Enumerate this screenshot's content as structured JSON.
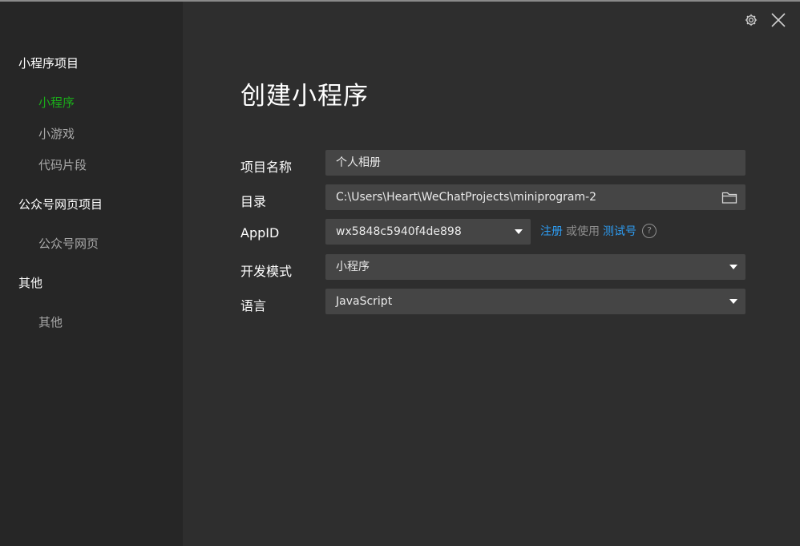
{
  "sidebar": {
    "groups": [
      {
        "title": "小程序项目",
        "items": [
          "小程序",
          "小游戏",
          "代码片段"
        ]
      },
      {
        "title": "公众号网页项目",
        "items": [
          "公众号网页"
        ]
      },
      {
        "title": "其他",
        "items": [
          "其他"
        ]
      }
    ],
    "active_item": "小程序"
  },
  "header": {
    "settings_icon": "gear-icon",
    "close_icon": "close-icon"
  },
  "main": {
    "title": "创建小程序",
    "form": {
      "project_name": {
        "label": "项目名称",
        "value": "个人相册"
      },
      "directory": {
        "label": "目录",
        "value": "C:\\Users\\Heart\\WeChatProjects\\miniprogram-2",
        "icon": "folder-icon"
      },
      "appid": {
        "label": "AppID",
        "value": "wx5848c5940f4de898",
        "register_link": "注册",
        "or_text": "或使用",
        "test_link": "测试号",
        "help": "?"
      },
      "dev_mode": {
        "label": "开发模式",
        "value": "小程序"
      },
      "language": {
        "label": "语言",
        "value": "JavaScript"
      }
    }
  },
  "colors": {
    "accent_green": "#1aad19",
    "link_blue": "#2d9bf0",
    "sidebar_bg": "#262626",
    "main_bg": "#2e2e2e",
    "field_bg": "#454545"
  }
}
